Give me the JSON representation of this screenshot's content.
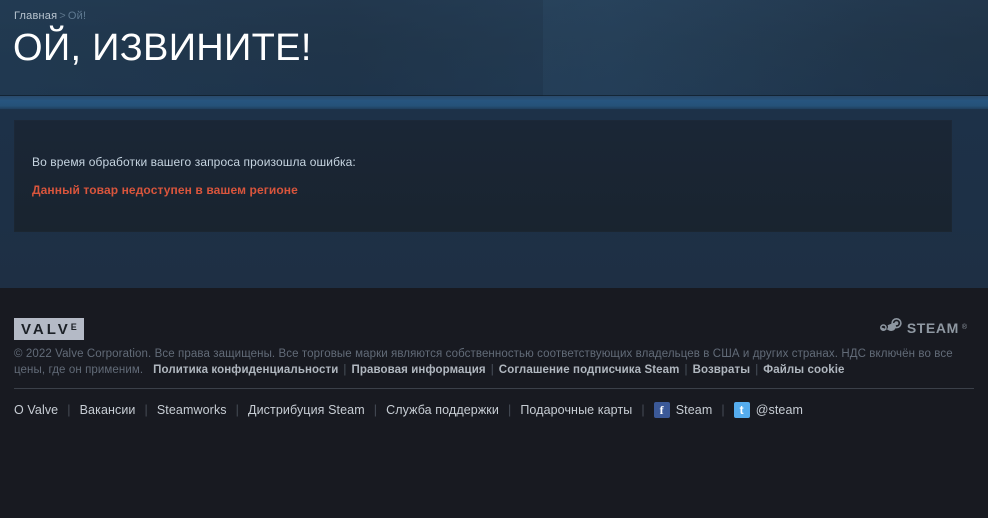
{
  "header": {
    "breadcrumb": {
      "home_label": "Главная",
      "separator": ">",
      "current_label": "Ой!"
    },
    "title": "ОЙ, ИЗВИНИТЕ!"
  },
  "content": {
    "error_intro": "Во время обработки вашего запроса произошла ошибка:",
    "error_detail": "Данный товар недоступен в вашем регионе",
    "error_color": "#d9553c"
  },
  "footer": {
    "valve_logo": {
      "main": "VALV",
      "sup": "E"
    },
    "steam_logo": {
      "word": "STEAM",
      "tm": "®"
    },
    "legal": {
      "copyright": "© 2022 Valve Corporation. Все права защищены. Все торговые марки являются собственностью соответствующих владельцев в США и других странах.",
      "vat": "НДС включён во все цены, где он применим.",
      "links": [
        "Политика конфиденциальности",
        "Правовая информация",
        "Соглашение подписчика Steam",
        "Возвраты",
        "Файлы cookie"
      ],
      "separator": "|"
    },
    "nav": {
      "separator": "|",
      "items": [
        "О Valve",
        "Вакансии",
        "Steamworks",
        "Дистрибуция Steam",
        "Служба поддержки",
        "Подарочные карты"
      ],
      "social": [
        {
          "icon": "facebook-icon",
          "glyph": "f",
          "label": "Steam",
          "color": "#3b5998"
        },
        {
          "icon": "twitter-icon",
          "glyph": "t",
          "label": "@steam",
          "color": "#55acee"
        }
      ]
    }
  }
}
